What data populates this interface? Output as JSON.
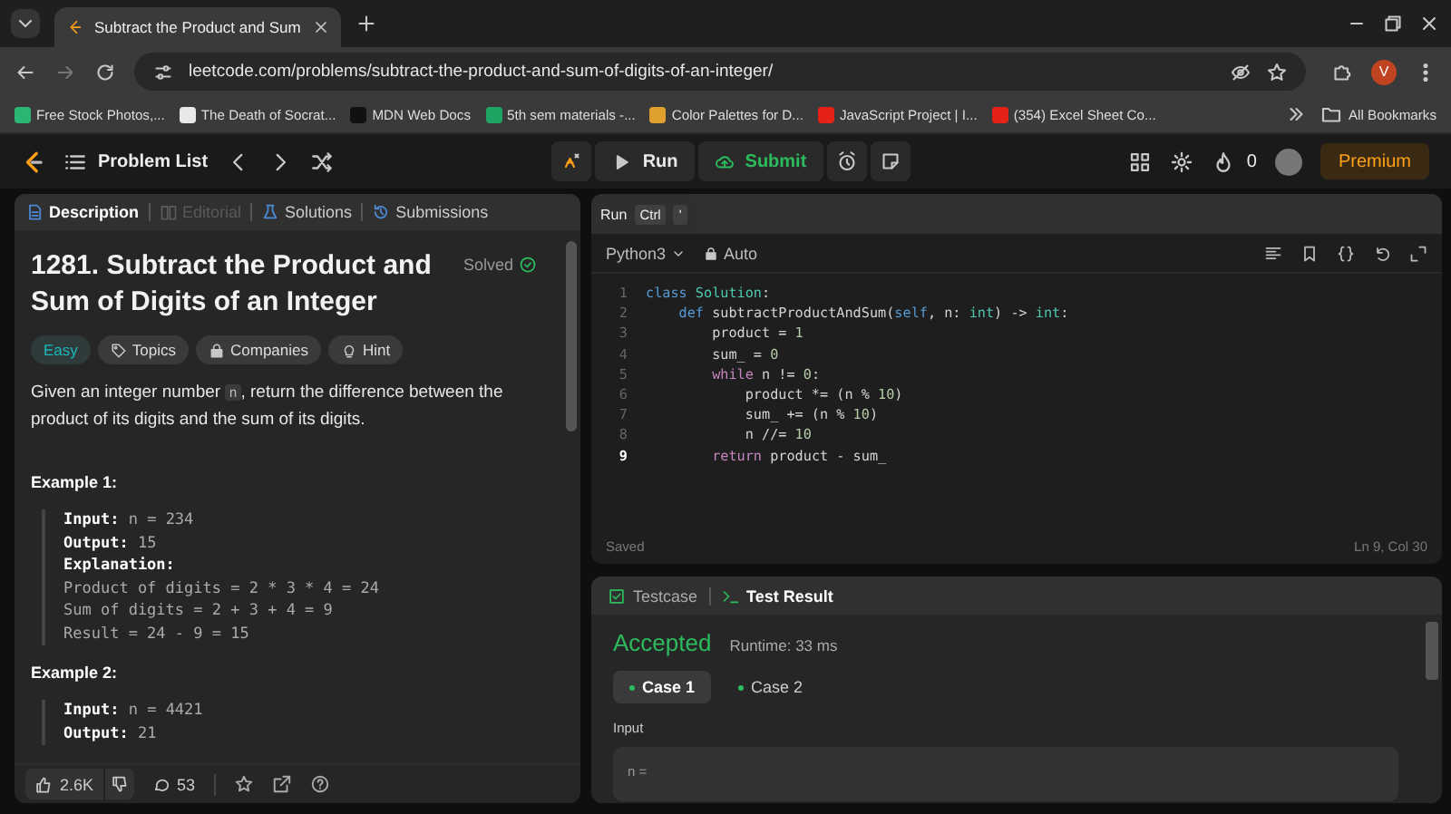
{
  "browser": {
    "tabs": [
      {
        "title": "Subtract the Product and Sum",
        "selected": true
      }
    ],
    "url": "leetcode.com/problems/subtract-the-product-and-sum-of-digits-of-an-integer/",
    "bookmarks": [
      {
        "label": "Free Stock Photos,...",
        "color": "#2bb673"
      },
      {
        "label": "The Death of Socrat...",
        "color": "#e8e8e8"
      },
      {
        "label": "MDN Web Docs",
        "color": "#111111"
      },
      {
        "label": "5th sem materials -...",
        "color": "#1fa463"
      },
      {
        "label": "Color Palettes for D...",
        "color": "#e0a030"
      },
      {
        "label": "JavaScript Project | I...",
        "color": "#e62117"
      },
      {
        "label": "(354) Excel Sheet Co...",
        "color": "#e62117"
      }
    ],
    "all_bookmarks": "All Bookmarks",
    "avatar": "V"
  },
  "nav": {
    "problem_list": "Problem List",
    "run": "Run",
    "submit": "Submit",
    "streak": "0",
    "premium": "Premium"
  },
  "tooltip": {
    "label": "Run",
    "keys": [
      "Ctrl",
      "'"
    ]
  },
  "left_tabs": [
    {
      "label": "Description",
      "selected": true,
      "disabled": false
    },
    {
      "label": "Editorial",
      "selected": false,
      "disabled": true
    },
    {
      "label": "Solutions",
      "selected": false,
      "disabled": false
    },
    {
      "label": "Submissions",
      "selected": false,
      "disabled": false
    }
  ],
  "problem": {
    "title": "1281. Subtract the Product and Sum of Digits of an Integer",
    "status": "Solved",
    "tags": [
      {
        "label": "Easy",
        "kind": "difficulty"
      },
      {
        "label": "Topics",
        "kind": "topics"
      },
      {
        "label": "Companies",
        "kind": "companies"
      },
      {
        "label": "Hint",
        "kind": "hint"
      }
    ],
    "description": [
      {
        "text": "Given an integer number ",
        "kind": "text"
      },
      {
        "text": "n",
        "kind": "code"
      },
      {
        "text": ", return the difference between the product of its digits and the sum of its digits.",
        "kind": "text"
      }
    ],
    "examples": [
      {
        "title": "Example 1:",
        "lines": [
          {
            "label": "Input:",
            "value": "n = 234"
          },
          {
            "label": "Output:",
            "value": "15"
          },
          {
            "label": "Explanation:"
          },
          {
            "value": "Product of digits = 2 * 3 * 4 = 24"
          },
          {
            "value": "Sum of digits = 2 + 3 + 4 = 9"
          },
          {
            "value": "Result = 24 - 9 = 15"
          }
        ]
      },
      {
        "title": "Example 2:",
        "lines": [
          {
            "label": "Input:",
            "value": "n = 4421"
          },
          {
            "label": "Output:",
            "value": "21"
          }
        ]
      }
    ]
  },
  "footer": {
    "likes": "2.6K",
    "comments": "53"
  },
  "editor": {
    "language": "Python3",
    "mode": "Auto",
    "lines": [
      {
        "num": "1",
        "current": false,
        "tokens": [
          {
            "text": "class",
            "kind": "keyword"
          },
          {
            "text": " Solution",
            "kind": "type"
          },
          {
            "text": ":",
            "kind": "plain"
          }
        ]
      },
      {
        "num": "2",
        "current": false,
        "tokens": [
          {
            "text": "    def",
            "kind": "keyword"
          },
          {
            "text": " subtractProductAndSum(",
            "kind": "plain"
          },
          {
            "text": "self",
            "kind": "keyword"
          },
          {
            "text": ", n: ",
            "kind": "plain"
          },
          {
            "text": "int",
            "kind": "type"
          },
          {
            "text": ") -> ",
            "kind": "plain"
          },
          {
            "text": "int",
            "kind": "type"
          },
          {
            "text": ":",
            "kind": "plain"
          }
        ]
      },
      {
        "num": "3",
        "current": false,
        "tokens": [
          {
            "text": "        product = ",
            "kind": "plain"
          },
          {
            "text": "1",
            "kind": "number"
          }
        ]
      },
      {
        "num": "4",
        "current": false,
        "tokens": [
          {
            "text": "        sum_ = ",
            "kind": "plain"
          },
          {
            "text": "0",
            "kind": "number"
          }
        ]
      },
      {
        "num": "5",
        "current": false,
        "tokens": [
          {
            "text": "        while",
            "kind": "control"
          },
          {
            "text": " n != ",
            "kind": "plain"
          },
          {
            "text": "0",
            "kind": "number"
          },
          {
            "text": ":",
            "kind": "plain"
          }
        ]
      },
      {
        "num": "6",
        "current": false,
        "tokens": [
          {
            "text": "            product *= (n % ",
            "kind": "plain"
          },
          {
            "text": "10",
            "kind": "number"
          },
          {
            "text": ")",
            "kind": "plain"
          }
        ]
      },
      {
        "num": "7",
        "current": false,
        "tokens": [
          {
            "text": "            sum_ += (n % ",
            "kind": "plain"
          },
          {
            "text": "10",
            "kind": "number"
          },
          {
            "text": ")",
            "kind": "plain"
          }
        ]
      },
      {
        "num": "8",
        "current": false,
        "tokens": [
          {
            "text": "            n //= ",
            "kind": "plain"
          },
          {
            "text": "10",
            "kind": "number"
          }
        ]
      },
      {
        "num": "9",
        "current": true,
        "tokens": [
          {
            "text": "        return",
            "kind": "control"
          },
          {
            "text": " product - sum_",
            "kind": "plain"
          }
        ]
      }
    ],
    "status_left": "Saved",
    "status_right": "Ln 9, Col 30"
  },
  "result": {
    "tabs": [
      {
        "label": "Testcase",
        "selected": false
      },
      {
        "label": "Test Result",
        "selected": true
      }
    ],
    "verdict": "Accepted",
    "runtime": "Runtime: 33 ms",
    "cases": [
      {
        "label": "Case 1",
        "selected": true
      },
      {
        "label": "Case 2",
        "selected": false
      }
    ],
    "input_label": "Input",
    "input_value": "n ="
  }
}
